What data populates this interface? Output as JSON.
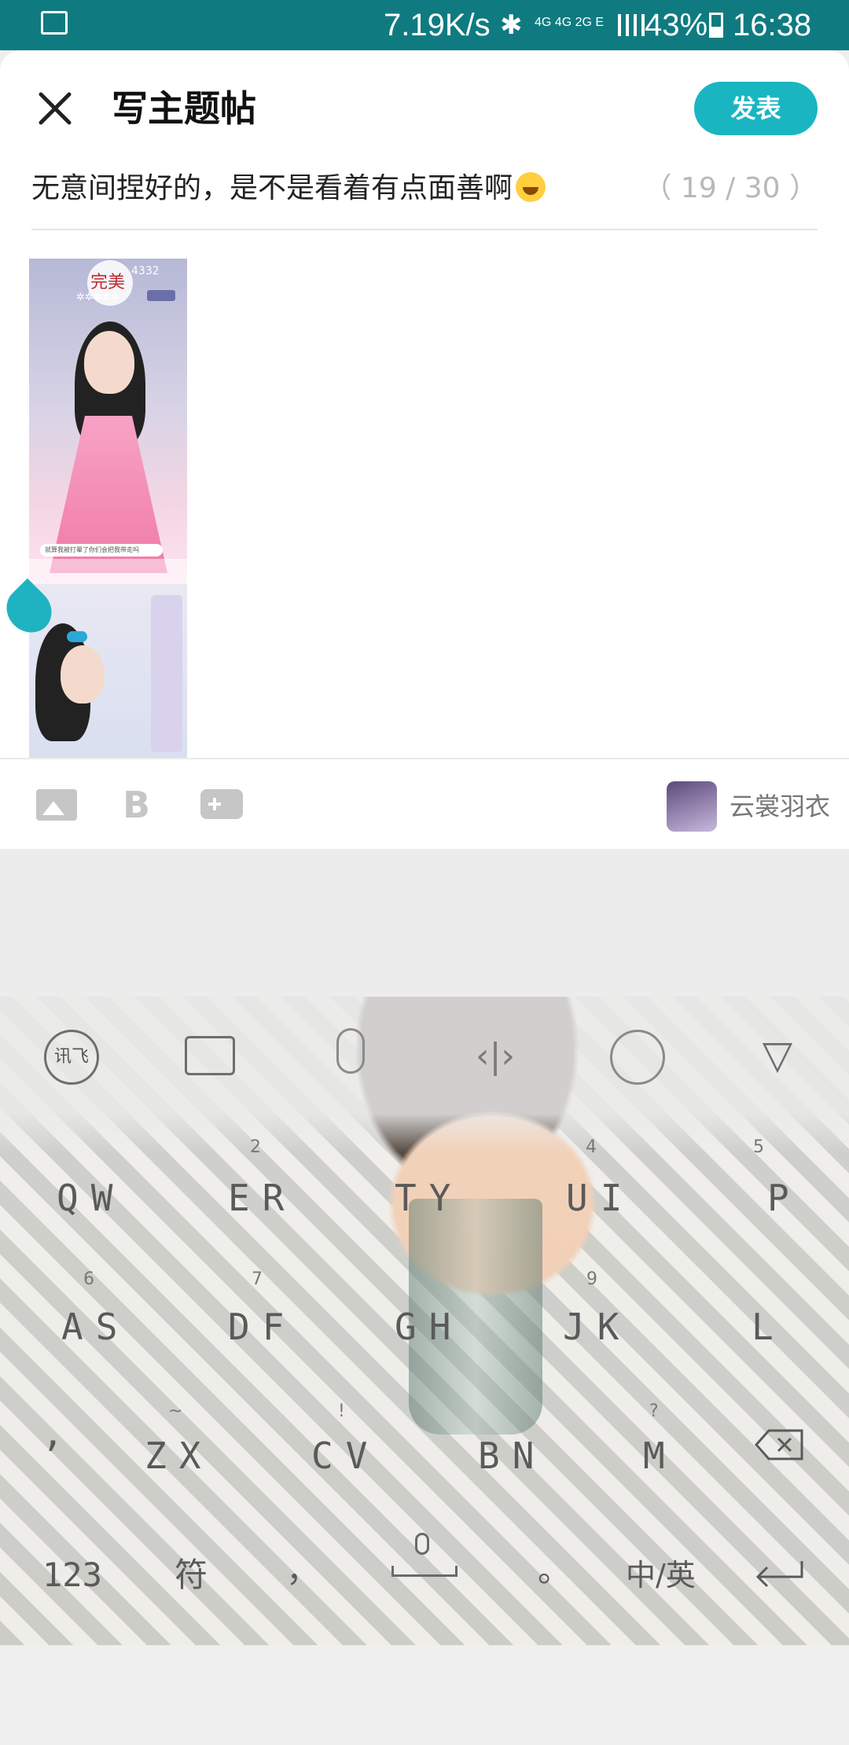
{
  "status_bar": {
    "speed": "7.19K/s",
    "network": "4G 4G 2G E",
    "battery": "43%",
    "time": "16:38"
  },
  "header": {
    "title": "写主题帖",
    "publish_label": "发表"
  },
  "post": {
    "title_text": "无意间捏好的，是不是看着有点面善啊",
    "char_count": "（ 19 / 30 ）"
  },
  "attachments": [
    {
      "badge_text": "完美",
      "score": "4332",
      "caption": "就算我被打晕了你们会把我带走吗"
    },
    {
      "badge_text": ""
    }
  ],
  "toolbar": {
    "game_name": "云裳羽衣",
    "icons": [
      "image-icon",
      "bold-icon",
      "game-icon"
    ]
  },
  "keyboard": {
    "top_icons": [
      "讯飞",
      "keyboard-icon",
      "microphone-icon",
      "cursor-icon",
      "emoji-icon",
      "collapse-icon"
    ],
    "row1": {
      "keys": [
        "QW",
        "ER",
        "TY",
        "UI",
        "P"
      ],
      "subs": [
        "",
        "2",
        "",
        "4",
        "5"
      ]
    },
    "row2": {
      "keys": [
        "AS",
        "DF",
        "GH",
        "JK",
        "L"
      ],
      "subs": [
        "6",
        "7",
        "",
        "9",
        ""
      ]
    },
    "row3": {
      "keys": [
        "’",
        "ZX",
        "CV",
        "BN",
        "M"
      ],
      "subs": [
        "",
        "~",
        "!",
        "",
        "?"
      ]
    },
    "row4": {
      "k123": "123",
      "symbols": "符",
      "comma": "，",
      "period": "。",
      "lang": "中/英"
    }
  }
}
